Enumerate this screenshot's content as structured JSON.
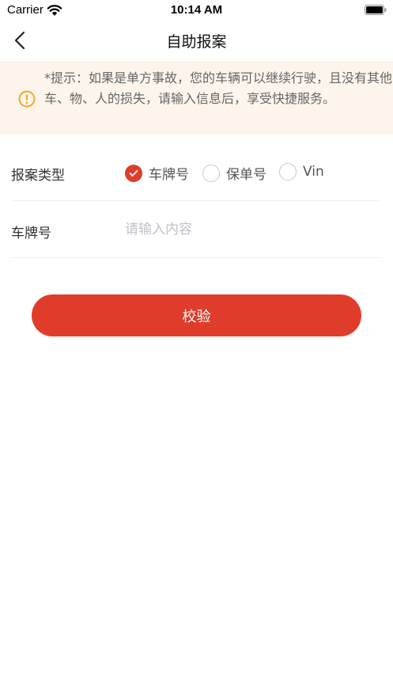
{
  "status_bar": {
    "carrier": "Carrier",
    "time": "10:14 AM"
  },
  "nav": {
    "title": "自助报案",
    "back_icon": "chevron-left-icon"
  },
  "notice": {
    "icon": "warning-circle-icon",
    "text": "*提示：如果是单方事故，您的车辆可以继续行驶，且没有其他车、物、人的损失，请输入信息后，享受快捷服务。",
    "color_bg": "#fdf5ec",
    "color_icon": "#f5a623"
  },
  "form": {
    "report_type": {
      "label": "报案类型",
      "options": [
        {
          "label": "车牌号",
          "selected": true
        },
        {
          "label": "保单号",
          "selected": false
        },
        {
          "label": "Vin",
          "selected": false
        }
      ]
    },
    "plate": {
      "label": "车牌号",
      "value": "",
      "placeholder": "请输入内容"
    }
  },
  "submit": {
    "label": "校验"
  },
  "colors": {
    "accent": "#e03c2b"
  }
}
